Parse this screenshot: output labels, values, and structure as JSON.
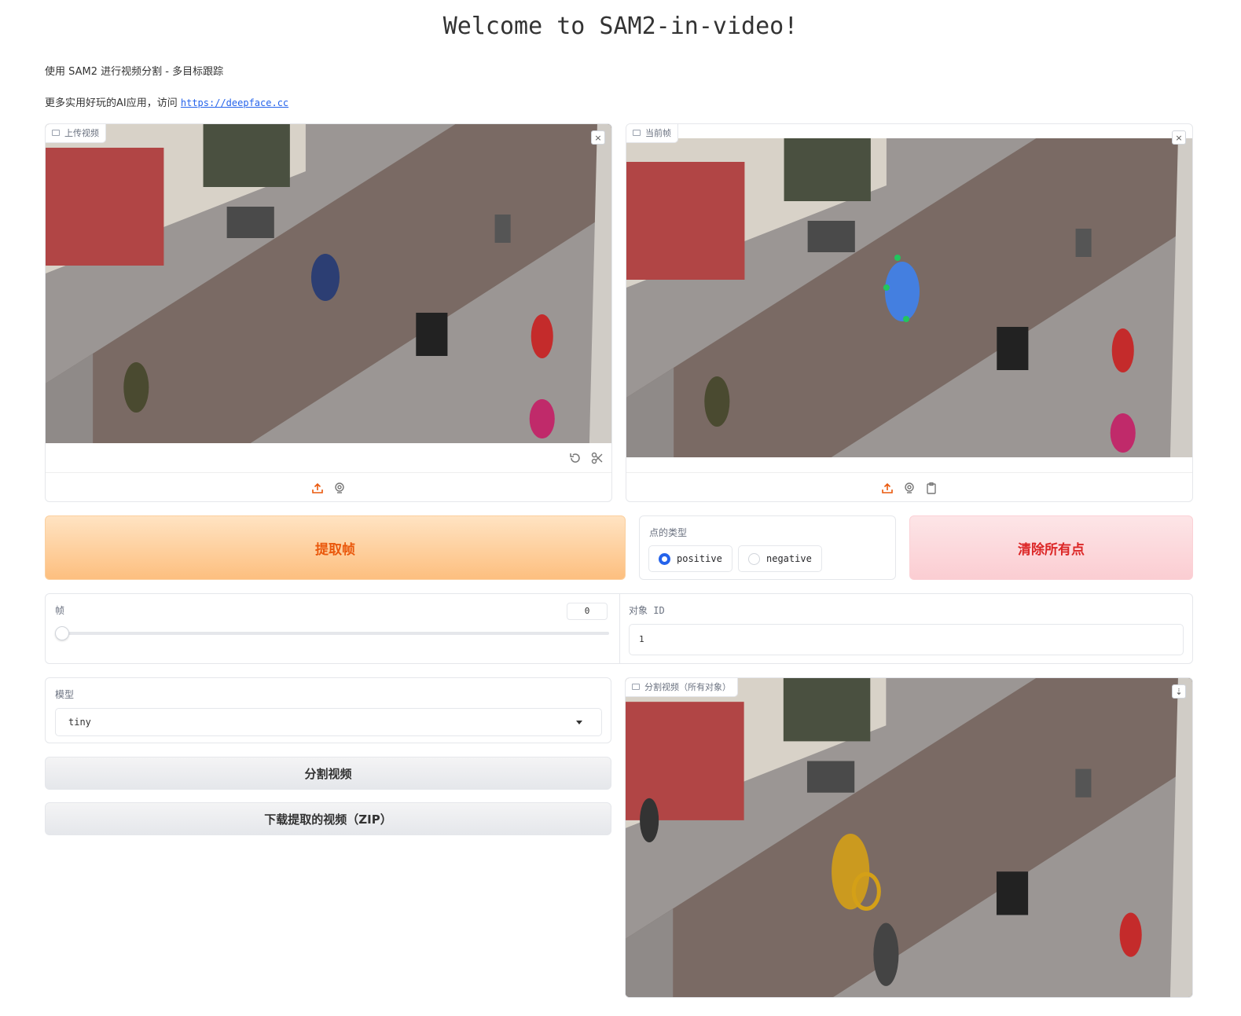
{
  "header": {
    "title": "Welcome to SAM2-in-video!",
    "subtitle": "使用 SAM2 进行视频分割 - 多目标跟踪",
    "more_text": "更多实用好玩的AI应用，访问 ",
    "more_link": "https://deepface.cc"
  },
  "upload_video": {
    "label": "上传视频",
    "close": "×"
  },
  "current_frame": {
    "label": "当前帧",
    "close": "×"
  },
  "buttons": {
    "extract": "提取帧",
    "clear": "清除所有点",
    "segment": "分割视频",
    "download": "下载提取的视频（ZIP）"
  },
  "point_type": {
    "label": "点的类型",
    "options": [
      "positive",
      "negative"
    ],
    "selected": "positive"
  },
  "frame": {
    "label": "帧",
    "value": "0"
  },
  "object_id": {
    "label": "对象 ID",
    "value": "1"
  },
  "model": {
    "label": "模型",
    "value": "tiny"
  },
  "segmented_video": {
    "label": "分割视频（所有对象）",
    "download": "⇣"
  },
  "colors": {
    "accent_orange": "#ea580c",
    "accent_red": "#dc2626",
    "radio_blue": "#2563eb",
    "mask_blue": "#3b82f6",
    "mask_gold": "#d4a017"
  }
}
